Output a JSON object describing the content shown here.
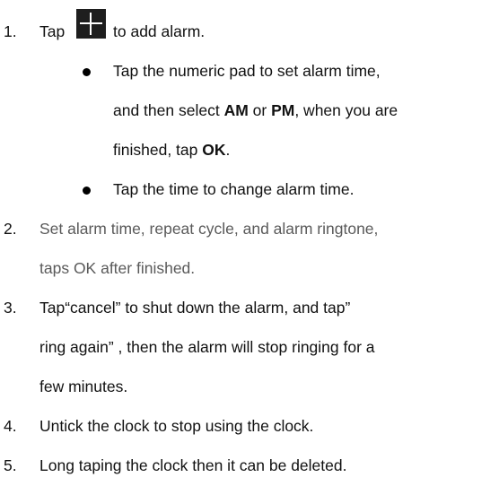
{
  "step1": {
    "number": "1.",
    "before_icon": "Tap",
    "icon": "plus-icon",
    "after_icon": "to add alarm.",
    "bullet_a": {
      "line1": "Tap the numeric pad to set alarm time,",
      "line2_pre": "and then select ",
      "am": "AM",
      "or": " or ",
      "pm": "PM",
      "line2_post": ", when you are",
      "line3_pre": "finished, tap ",
      "ok": "OK",
      "line3_post": "."
    },
    "bullet_b": "Tap the time to change alarm time."
  },
  "step2": {
    "number": "2.",
    "line1": "Set alarm time, repeat cycle, and alarm ringtone,",
    "line2": "taps OK after finished."
  },
  "step3": {
    "number": "3.",
    "line1": "Tap“cancel” to shut down the alarm, and tap”",
    "line2": "ring again” , then the alarm will stop ringing for a",
    "line3": "few minutes."
  },
  "step4": {
    "number": "4.",
    "text": "Untick the clock to stop using the clock."
  },
  "step5": {
    "number": "5.",
    "text": "Long taping the clock then it can be deleted."
  }
}
